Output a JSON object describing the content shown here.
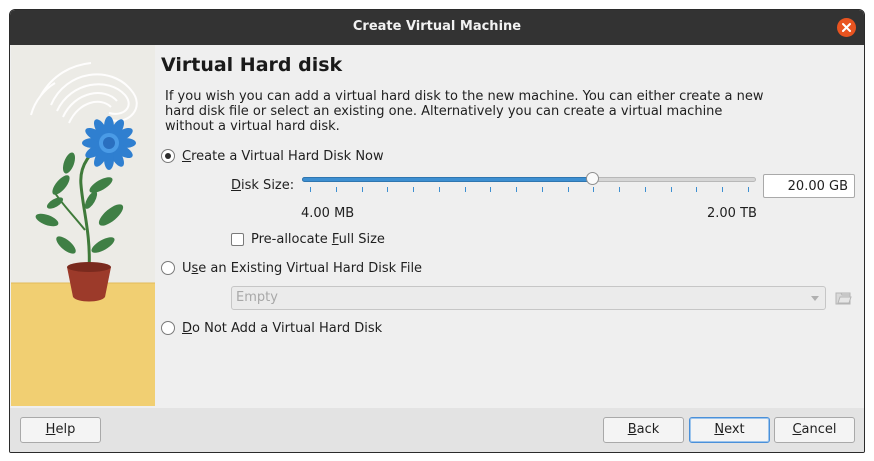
{
  "window": {
    "title": "Create Virtual Machine",
    "close_icon": "close-icon",
    "accent_color": "#e95420"
  },
  "page": {
    "heading": "Virtual Hard disk",
    "description_lines": [
      "If you wish you can add a virtual hard disk to the new machine. You can either create a new",
      "hard disk file or select an existing one. Alternatively you can create a virtual machine",
      "without a virtual hard disk."
    ]
  },
  "options": {
    "create_now": {
      "mnemonic": "C",
      "rest": "reate a Virtual Hard Disk Now",
      "selected": true
    },
    "use_existing": {
      "prefix": "U",
      "mnemonic": "s",
      "rest": "e an Existing Virtual Hard Disk File",
      "selected": false
    },
    "do_not_add": {
      "mnemonic": "D",
      "rest": "o Not Add a Virtual Hard Disk",
      "selected": false
    }
  },
  "disk": {
    "label_mnemonic": "D",
    "label_rest": "isk Size:",
    "value": "20.00 GB",
    "min_label": "4.00 MB",
    "max_label": "2.00 TB",
    "slider_fraction": 0.64,
    "tick_count": 18,
    "preallocate": {
      "prefix": "Pre-allocate ",
      "mnemonic": "F",
      "rest": "ull Size",
      "checked": false
    }
  },
  "existing_file": {
    "selected_value": "Empty",
    "folder_icon": "folder-open-icon"
  },
  "buttons": {
    "help": {
      "mnemonic": "H",
      "rest": "elp"
    },
    "back": {
      "mnemonic": "B",
      "rest": "ack"
    },
    "next": {
      "mnemonic": "N",
      "rest": "ext"
    },
    "cancel": {
      "mnemonic": "C",
      "rest": "ancel"
    }
  },
  "colors": {
    "slider_fill": "#3d8fd1",
    "art_background": "#ecebe6",
    "art_table": "#f1cf72"
  }
}
